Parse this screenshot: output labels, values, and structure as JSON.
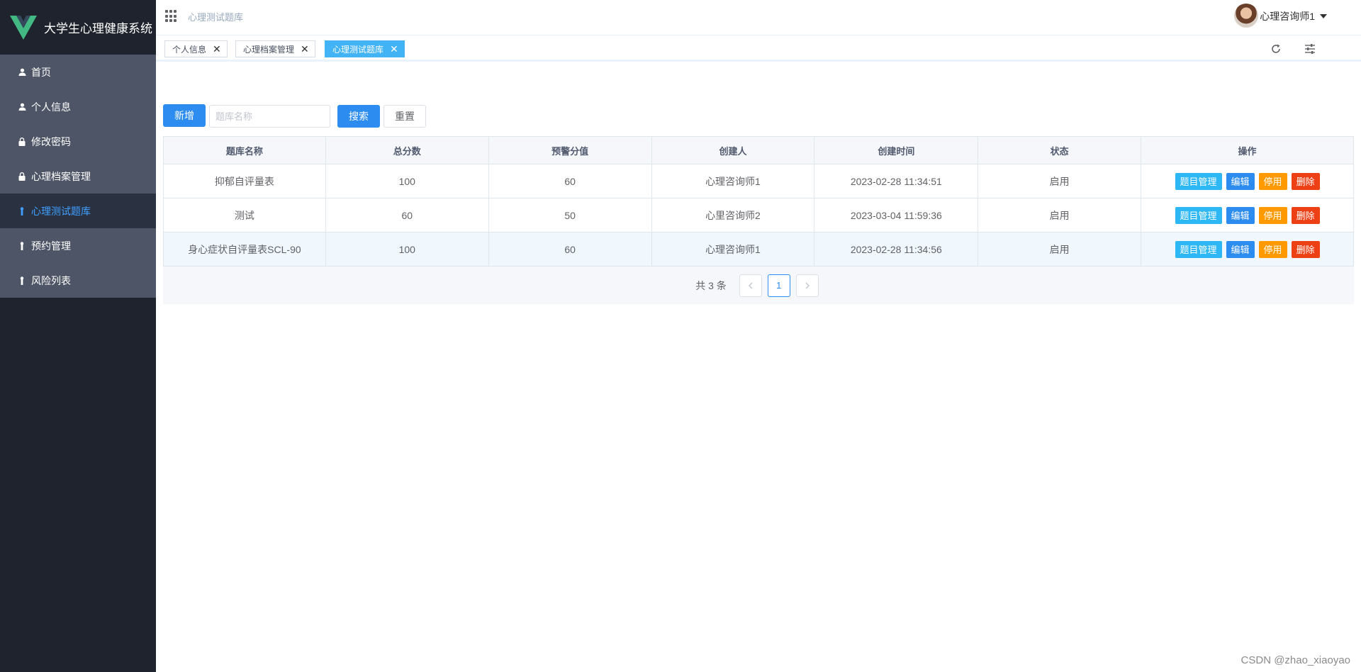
{
  "app": {
    "title": "大学生心理健康系统",
    "logo_icon": "vue-logo-icon",
    "brand_color": "#42b883"
  },
  "sidebar": {
    "items": [
      {
        "label": "首页",
        "icon": "user-icon",
        "active": false
      },
      {
        "label": "个人信息",
        "icon": "user-icon",
        "active": false
      },
      {
        "label": "修改密码",
        "icon": "lock-icon",
        "active": false
      },
      {
        "label": "心理档案管理",
        "icon": "lock-icon",
        "active": false
      },
      {
        "label": "心理测试题库",
        "icon": "pin-icon",
        "active": true
      },
      {
        "label": "预约管理",
        "icon": "pin-icon",
        "active": false
      },
      {
        "label": "风险列表",
        "icon": "pin-icon",
        "active": false
      }
    ]
  },
  "header": {
    "breadcrumb": "心理测试题库",
    "user_name": "心理咨询师1"
  },
  "tabs": [
    {
      "label": "个人信息",
      "active": false
    },
    {
      "label": "心理档案管理",
      "active": false
    },
    {
      "label": "心理测试题库",
      "active": true
    }
  ],
  "toolbar": {
    "add_label": "新增",
    "search_placeholder": "题库名称",
    "search_label": "搜索",
    "reset_label": "重置"
  },
  "table": {
    "columns": [
      "题库名称",
      "总分数",
      "预警分值",
      "创建人",
      "创建时间",
      "状态",
      "操作"
    ],
    "rows": [
      {
        "name": "抑郁自评量表",
        "total": "100",
        "warn": "60",
        "creator": "心理咨询师1",
        "created": "2023-02-28 11:34:51",
        "status": "启用"
      },
      {
        "name": "测试",
        "total": "60",
        "warn": "50",
        "creator": "心里咨询师2",
        "created": "2023-03-04 11:59:36",
        "status": "启用"
      },
      {
        "name": "身心症状自评量表SCL-90",
        "total": "100",
        "warn": "60",
        "creator": "心理咨询师1",
        "created": "2023-02-28 11:34:56",
        "status": "启用"
      }
    ],
    "actions": {
      "manage": "题目管理",
      "edit": "编辑",
      "stop": "停用",
      "delete": "删除"
    }
  },
  "pagination": {
    "total_text": "共 3 条",
    "current_page": "1"
  },
  "watermark": "CSDN @zhao_xiaoyao"
}
